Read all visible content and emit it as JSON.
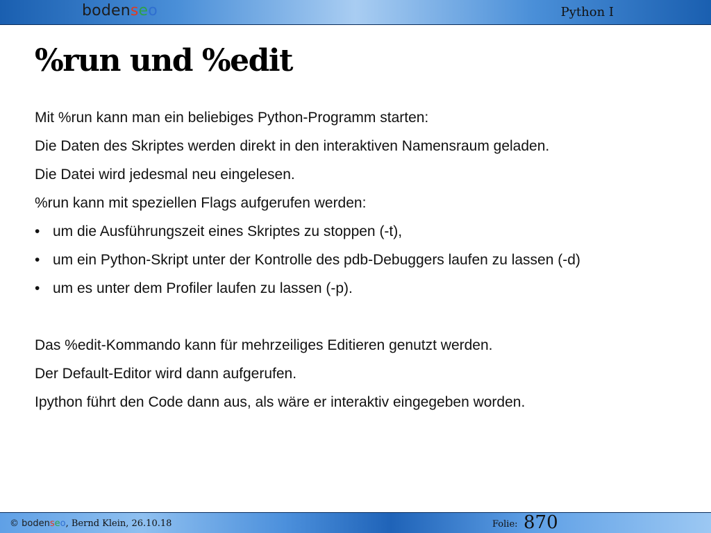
{
  "brand": {
    "seg_a": "boden",
    "seg_b": "s",
    "seg_c": "e",
    "seg_d": "o"
  },
  "header": {
    "course": "Python I"
  },
  "slide": {
    "title": "%run und %edit",
    "lines": [
      "Mit  %run kann man ein beliebiges Python-Programm starten:",
      "Die Daten des Skriptes werden direkt in den interaktiven Namensraum geladen.",
      "Die Datei wird jedesmal neu eingelesen.",
      "%run kann mit speziellen Flags aufgerufen werden:"
    ],
    "bullet_symbol": "•",
    "bullets": [
      "um die Ausführungszeit eines Skriptes zu stoppen  (-t),",
      "um ein Python-Skript unter der Kontrolle des pdb-Debuggers laufen zu lassen  (-d)",
      "um es unter dem Profiler laufen zu lassen (-p)."
    ],
    "lines2": [
      "Das %edit-Kommando kann für mehrzeiliges Editieren genutzt werden.",
      "Der Default-Editor wird dann aufgerufen.",
      "Ipython  führt den Code dann aus, als wäre er interaktiv eingegeben worden."
    ]
  },
  "footer": {
    "copyright": "©",
    "author_date": ", Bernd Klein, 26.10.18",
    "folie_label": "Folie:",
    "slide_number": "870"
  },
  "colors": {
    "accent_blue": "#1a5fb0",
    "logo_red": "#e23a1e",
    "logo_green": "#2da14a",
    "logo_blue": "#2f6fd0"
  }
}
